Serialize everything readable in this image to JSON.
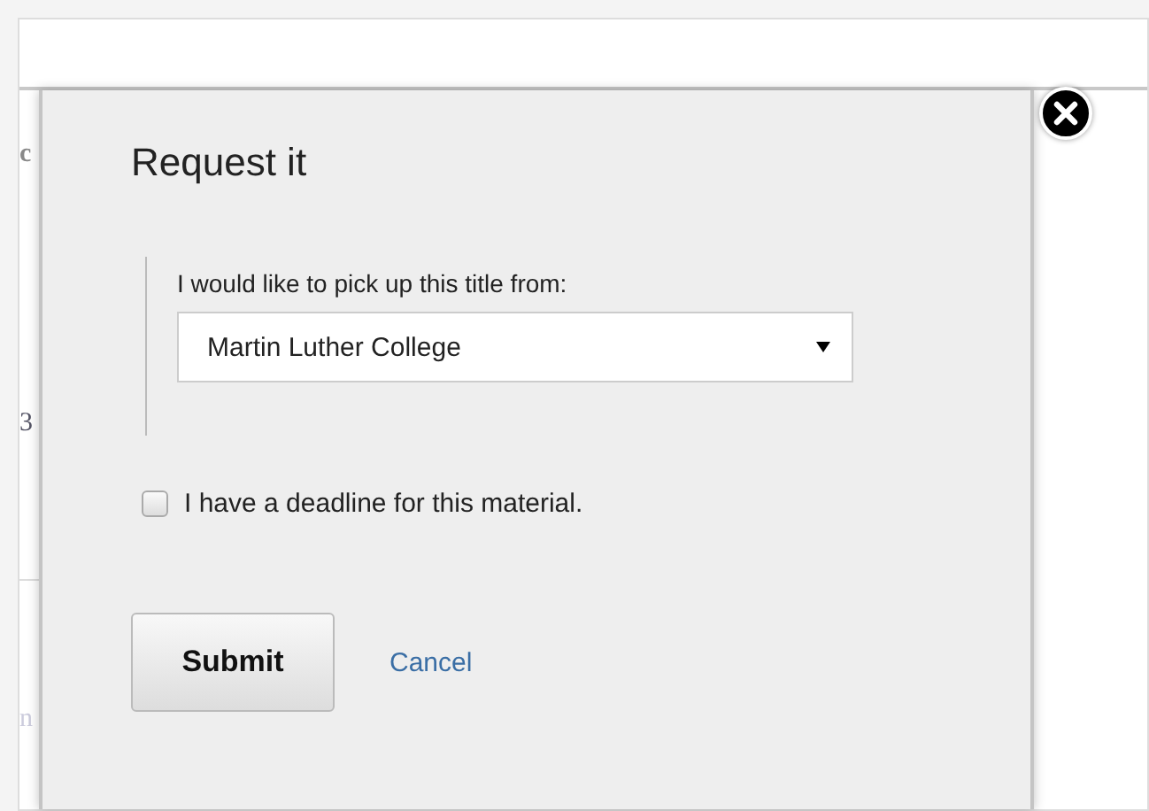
{
  "background_fragments": [
    "c",
    "3",
    "n"
  ],
  "dialog": {
    "title": "Request it",
    "pickup_label": "I would like to pick up this title from:",
    "pickup_select": {
      "value": "Martin Luther College"
    },
    "deadline_checkbox": {
      "label": "I have a deadline for this material.",
      "checked": false
    },
    "buttons": [
      {
        "label": "Submit",
        "kind": "primary"
      },
      {
        "label": "Cancel",
        "kind": "link"
      }
    ]
  }
}
